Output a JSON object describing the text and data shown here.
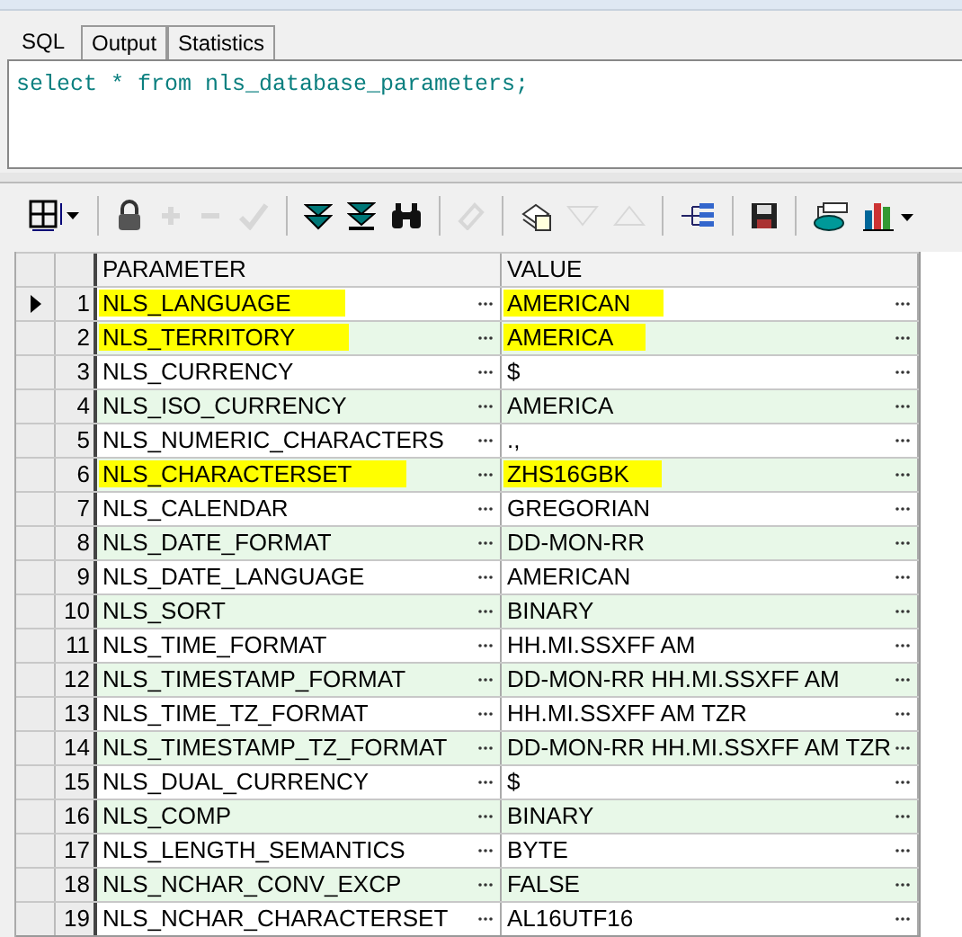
{
  "tabs": [
    {
      "label": "SQL",
      "selected": true
    },
    {
      "label": "Output",
      "selected": false
    },
    {
      "label": "Statistics",
      "selected": false
    }
  ],
  "editor": {
    "value": "select * from nls_database_parameters;"
  },
  "toolbar": [
    {
      "kind": "grid",
      "disabled": false
    },
    {
      "kind": "lock",
      "disabled": false
    },
    {
      "kind": "plus",
      "disabled": true
    },
    {
      "kind": "minus",
      "disabled": true
    },
    {
      "kind": "check",
      "disabled": true
    },
    {
      "kind": "fetch-next",
      "disabled": false
    },
    {
      "kind": "fetch-last",
      "disabled": false
    },
    {
      "kind": "binoculars",
      "disabled": false
    },
    {
      "kind": "eraser",
      "disabled": true
    },
    {
      "kind": "documents",
      "disabled": false
    },
    {
      "kind": "down",
      "disabled": true
    },
    {
      "kind": "up",
      "disabled": true
    },
    {
      "kind": "tree",
      "disabled": false
    },
    {
      "kind": "save",
      "disabled": false
    },
    {
      "kind": "export",
      "disabled": false
    },
    {
      "kind": "chart",
      "disabled": false
    }
  ],
  "table": {
    "columns": [
      "PARAMETER",
      "VALUE"
    ],
    "rows": [
      {
        "number": "1",
        "parameter": "NLS_LANGUAGE",
        "value": "AMERICAN",
        "current": true,
        "highlighted": true
      },
      {
        "number": "2",
        "parameter": "NLS_TERRITORY",
        "value": "AMERICA",
        "current": false,
        "highlighted": true
      },
      {
        "number": "3",
        "parameter": "NLS_CURRENCY",
        "value": "$",
        "current": false,
        "highlighted": false
      },
      {
        "number": "4",
        "parameter": "NLS_ISO_CURRENCY",
        "value": "AMERICA",
        "current": false,
        "highlighted": false
      },
      {
        "number": "5",
        "parameter": "NLS_NUMERIC_CHARACTERS",
        "value": ".,",
        "current": false,
        "highlighted": false
      },
      {
        "number": "6",
        "parameter": "NLS_CHARACTERSET",
        "value": "ZHS16GBK",
        "current": false,
        "highlighted": true
      },
      {
        "number": "7",
        "parameter": "NLS_CALENDAR",
        "value": "GREGORIAN",
        "current": false,
        "highlighted": false
      },
      {
        "number": "8",
        "parameter": "NLS_DATE_FORMAT",
        "value": "DD-MON-RR",
        "current": false,
        "highlighted": false
      },
      {
        "number": "9",
        "parameter": "NLS_DATE_LANGUAGE",
        "value": "AMERICAN",
        "current": false,
        "highlighted": false
      },
      {
        "number": "10",
        "parameter": "NLS_SORT",
        "value": "BINARY",
        "current": false,
        "highlighted": false
      },
      {
        "number": "11",
        "parameter": "NLS_TIME_FORMAT",
        "value": "HH.MI.SSXFF AM",
        "current": false,
        "highlighted": false
      },
      {
        "number": "12",
        "parameter": "NLS_TIMESTAMP_FORMAT",
        "value": "DD-MON-RR HH.MI.SSXFF AM",
        "current": false,
        "highlighted": false
      },
      {
        "number": "13",
        "parameter": "NLS_TIME_TZ_FORMAT",
        "value": "HH.MI.SSXFF AM TZR",
        "current": false,
        "highlighted": false
      },
      {
        "number": "14",
        "parameter": "NLS_TIMESTAMP_TZ_FORMAT",
        "value": "DD-MON-RR HH.MI.SSXFF AM TZR",
        "current": false,
        "highlighted": false
      },
      {
        "number": "15",
        "parameter": "NLS_DUAL_CURRENCY",
        "value": "$",
        "current": false,
        "highlighted": false
      },
      {
        "number": "16",
        "parameter": "NLS_COMP",
        "value": "BINARY",
        "current": false,
        "highlighted": false
      },
      {
        "number": "17",
        "parameter": "NLS_LENGTH_SEMANTICS",
        "value": "BYTE",
        "current": false,
        "highlighted": false
      },
      {
        "number": "18",
        "parameter": "NLS_NCHAR_CONV_EXCP",
        "value": "FALSE",
        "current": false,
        "highlighted": false
      },
      {
        "number": "19",
        "parameter": "NLS_NCHAR_CHARACTERSET",
        "value": "AL16UTF16",
        "current": false,
        "highlighted": false
      }
    ]
  }
}
